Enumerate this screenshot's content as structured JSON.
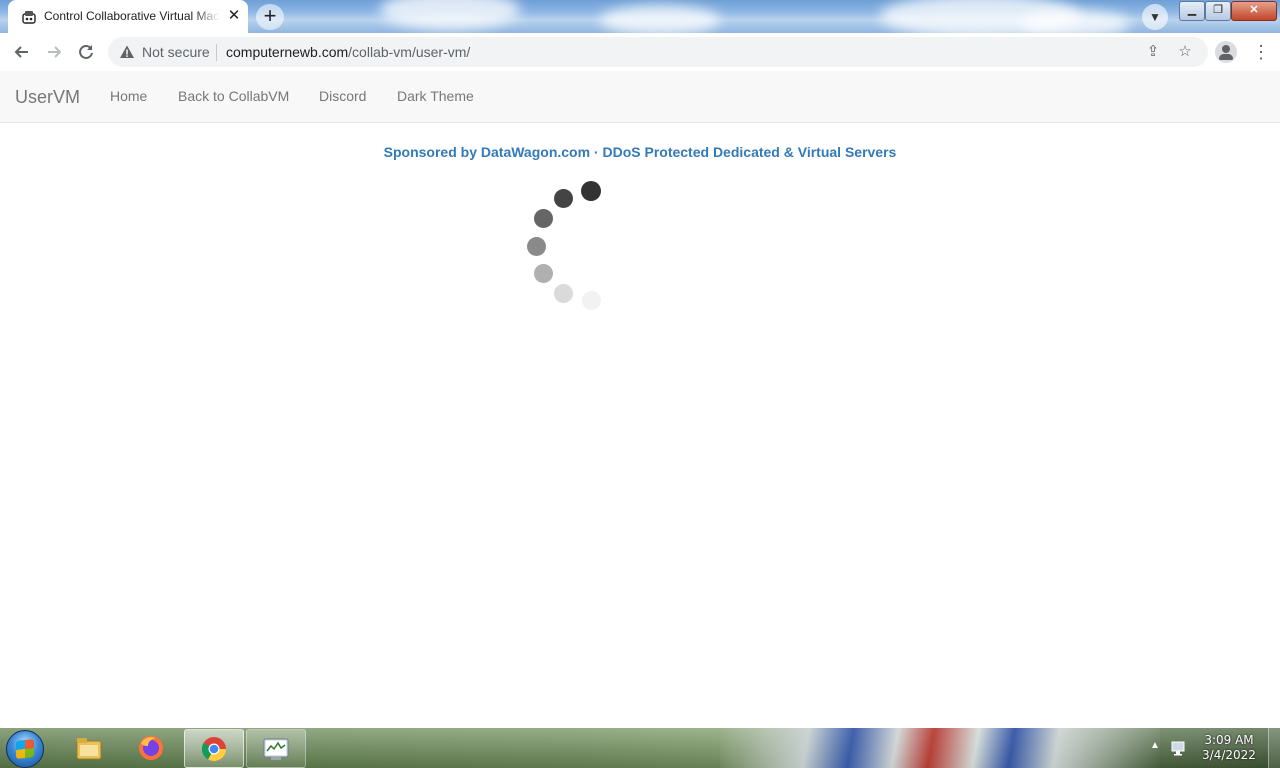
{
  "browser": {
    "tab_title": "Control Collaborative Virtual Machines",
    "tab_close": "✕",
    "new_tab": "+",
    "security_label": "Not secure",
    "url_host": "computernewb.com",
    "url_path": "/collab-vm/user-vm/"
  },
  "nav": {
    "brand": "UserVM",
    "links": [
      "Home",
      "Back to CollabVM",
      "Discord",
      "Dark Theme"
    ]
  },
  "content": {
    "sponsor": "Sponsored by DataWagon.com · DDoS Protected Dedicated & Virtual Servers",
    "spinner_state": "loading"
  },
  "taskbar": {
    "clock_time": "3:09 AM",
    "clock_date": "3/4/2022",
    "items": [
      "windows-explorer",
      "firefox",
      "chrome",
      "task-manager"
    ]
  },
  "colors": {
    "sponsor_link": "#337ab7",
    "nav_text": "#777777",
    "navbar_bg": "#f8f8f8"
  }
}
